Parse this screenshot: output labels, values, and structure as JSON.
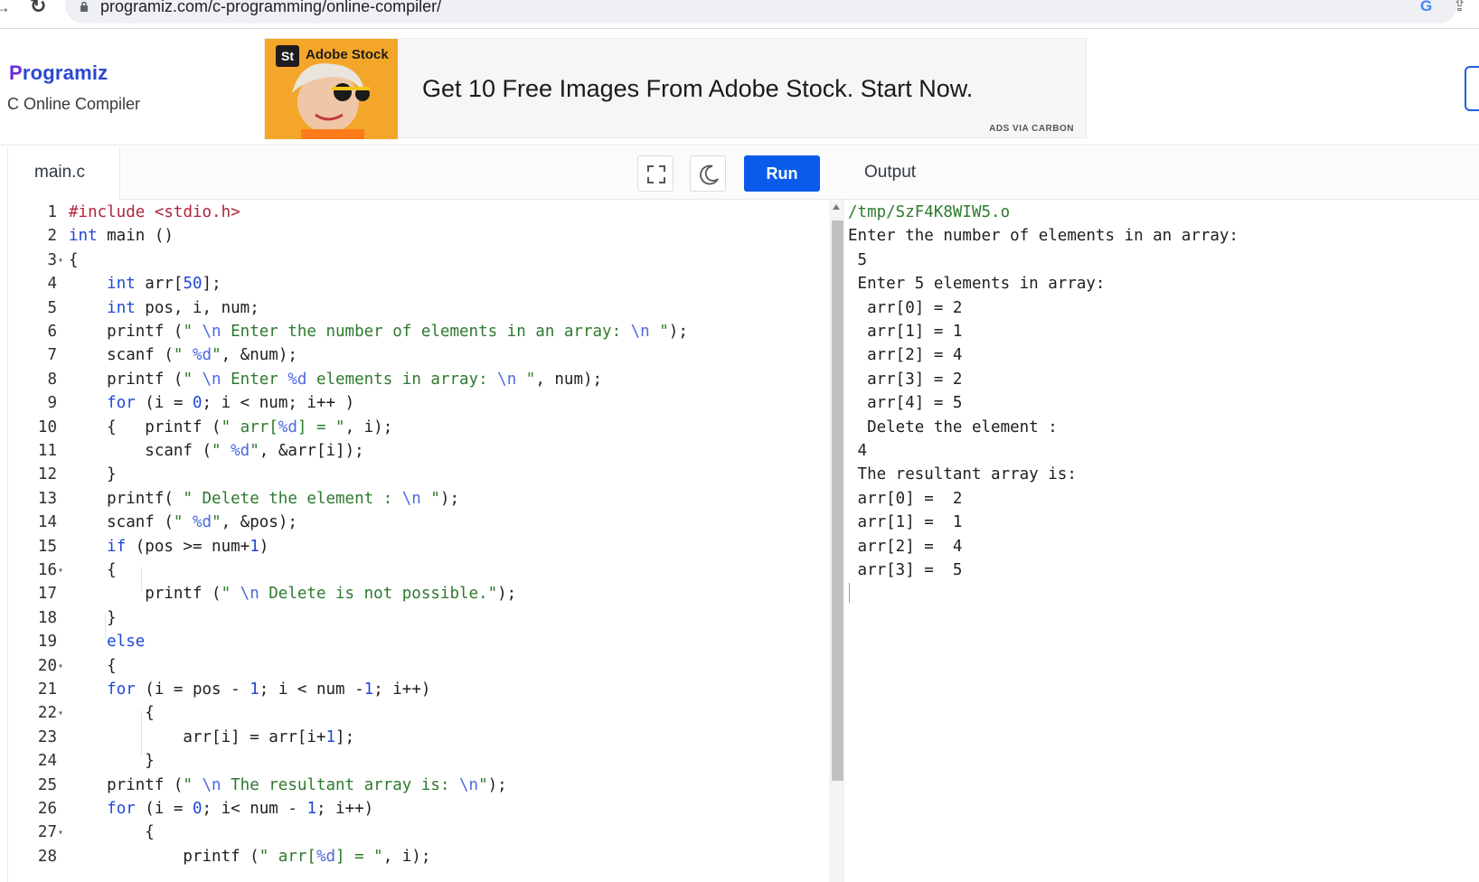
{
  "browser": {
    "url": "programiz.com/c-programming/online-compiler/",
    "back_glyph": "→",
    "reload_glyph": "↻",
    "google_glyph": "G",
    "share_glyph": "⇪"
  },
  "header": {
    "logo_p": "P",
    "logo_rest": "rogramiz",
    "subtitle": "C Online Compiler"
  },
  "ad": {
    "badge": "St",
    "brand": "Adobe Stock",
    "headline": "Get 10 Free Images From Adobe Stock. Start Now.",
    "credit": "ADS VIA CARBON"
  },
  "editor": {
    "file_tab": "main.c",
    "run_label": "Run",
    "lines": [
      {
        "n": "1",
        "fold": "",
        "tokens": [
          [
            "inc",
            "#include"
          ],
          [
            "",
            " "
          ],
          [
            "inc",
            "<stdio.h>"
          ]
        ]
      },
      {
        "n": "2",
        "fold": "",
        "tokens": [
          [
            "kw",
            "int"
          ],
          [
            "",
            " main ()"
          ]
        ]
      },
      {
        "n": "3",
        "fold": "▾",
        "tokens": [
          [
            "",
            "{"
          ]
        ]
      },
      {
        "n": "4",
        "fold": "",
        "tokens": [
          [
            "",
            "    "
          ],
          [
            "kw",
            "int"
          ],
          [
            "",
            " arr["
          ],
          [
            "num",
            "50"
          ],
          [
            "",
            "];"
          ]
        ]
      },
      {
        "n": "5",
        "fold": "",
        "tokens": [
          [
            "",
            "    "
          ],
          [
            "kw",
            "int"
          ],
          [
            "",
            " pos, i, num;"
          ]
        ]
      },
      {
        "n": "6",
        "fold": "",
        "tokens": [
          [
            "",
            "    printf ("
          ],
          [
            "str",
            "\" "
          ],
          [
            "esc",
            "\\n"
          ],
          [
            "str",
            " Enter the number of elements in an array: "
          ],
          [
            "esc",
            "\\n"
          ],
          [
            "str",
            " \""
          ],
          [
            "",
            ");"
          ]
        ]
      },
      {
        "n": "7",
        "fold": "",
        "tokens": [
          [
            "",
            "    scanf ("
          ],
          [
            "str",
            "\" "
          ],
          [
            "esc",
            "%d"
          ],
          [
            "str",
            "\""
          ],
          [
            "",
            ", &num);"
          ]
        ]
      },
      {
        "n": "8",
        "fold": "",
        "tokens": [
          [
            "",
            "    printf ("
          ],
          [
            "str",
            "\" "
          ],
          [
            "esc",
            "\\n"
          ],
          [
            "str",
            " Enter "
          ],
          [
            "esc",
            "%d"
          ],
          [
            "str",
            " elements in array: "
          ],
          [
            "esc",
            "\\n"
          ],
          [
            "str",
            " \""
          ],
          [
            "",
            ", num);"
          ]
        ]
      },
      {
        "n": "9",
        "fold": "",
        "tokens": [
          [
            "",
            "    "
          ],
          [
            "kw",
            "for"
          ],
          [
            "",
            " (i = "
          ],
          [
            "num",
            "0"
          ],
          [
            "",
            "; i < num; i++ )"
          ]
        ]
      },
      {
        "n": "10",
        "fold": "",
        "tokens": [
          [
            "",
            "    {   printf ("
          ],
          [
            "str",
            "\" arr["
          ],
          [
            "esc",
            "%d"
          ],
          [
            "str",
            "] = \""
          ],
          [
            "",
            ", i);"
          ]
        ]
      },
      {
        "n": "11",
        "fold": "",
        "tokens": [
          [
            "",
            "        scanf ("
          ],
          [
            "str",
            "\" "
          ],
          [
            "esc",
            "%d"
          ],
          [
            "str",
            "\""
          ],
          [
            "",
            ", &arr[i]);"
          ]
        ]
      },
      {
        "n": "12",
        "fold": "",
        "tokens": [
          [
            "",
            "    }"
          ]
        ]
      },
      {
        "n": "13",
        "fold": "",
        "tokens": [
          [
            "",
            "    printf( "
          ],
          [
            "str",
            "\" Delete the element : "
          ],
          [
            "esc",
            "\\n"
          ],
          [
            "str",
            " \""
          ],
          [
            "",
            ");"
          ]
        ]
      },
      {
        "n": "14",
        "fold": "",
        "tokens": [
          [
            "",
            "    scanf ("
          ],
          [
            "str",
            "\" "
          ],
          [
            "esc",
            "%d"
          ],
          [
            "str",
            "\""
          ],
          [
            "",
            ", &pos);"
          ]
        ]
      },
      {
        "n": "15",
        "fold": "",
        "tokens": [
          [
            "",
            "    "
          ],
          [
            "kw",
            "if"
          ],
          [
            "",
            " (pos >= num+"
          ],
          [
            "num",
            "1"
          ],
          [
            "",
            ")"
          ]
        ]
      },
      {
        "n": "16",
        "fold": "▾",
        "tokens": [
          [
            "",
            "    {"
          ]
        ]
      },
      {
        "n": "17",
        "fold": "",
        "tokens": [
          [
            "",
            "        printf ("
          ],
          [
            "str",
            "\" "
          ],
          [
            "esc",
            "\\n"
          ],
          [
            "str",
            " Delete is not possible.\""
          ],
          [
            "",
            ");"
          ]
        ]
      },
      {
        "n": "18",
        "fold": "",
        "tokens": [
          [
            "",
            "    }"
          ]
        ]
      },
      {
        "n": "19",
        "fold": "",
        "tokens": [
          [
            "",
            "    "
          ],
          [
            "kw",
            "else"
          ]
        ]
      },
      {
        "n": "20",
        "fold": "▾",
        "tokens": [
          [
            "",
            "    {"
          ]
        ]
      },
      {
        "n": "21",
        "fold": "",
        "tokens": [
          [
            "",
            "    "
          ],
          [
            "kw",
            "for"
          ],
          [
            "",
            " (i = pos - "
          ],
          [
            "num",
            "1"
          ],
          [
            "",
            "; i < num -"
          ],
          [
            "num",
            "1"
          ],
          [
            "",
            "; i++)"
          ]
        ]
      },
      {
        "n": "22",
        "fold": "▾",
        "tokens": [
          [
            "",
            "        {"
          ]
        ]
      },
      {
        "n": "23",
        "fold": "",
        "tokens": [
          [
            "",
            "            arr[i] = arr[i+"
          ],
          [
            "num",
            "1"
          ],
          [
            "",
            "];"
          ]
        ]
      },
      {
        "n": "24",
        "fold": "",
        "tokens": [
          [
            "",
            "        }"
          ]
        ]
      },
      {
        "n": "25",
        "fold": "",
        "tokens": [
          [
            "",
            "    printf ("
          ],
          [
            "str",
            "\" "
          ],
          [
            "esc",
            "\\n"
          ],
          [
            "str",
            " The resultant array is: "
          ],
          [
            "esc",
            "\\n"
          ],
          [
            "str",
            "\""
          ],
          [
            "",
            ");"
          ]
        ]
      },
      {
        "n": "26",
        "fold": "",
        "tokens": [
          [
            "",
            "    "
          ],
          [
            "kw",
            "for"
          ],
          [
            "",
            " (i = "
          ],
          [
            "num",
            "0"
          ],
          [
            "",
            "; i< num - "
          ],
          [
            "num",
            "1"
          ],
          [
            "",
            "; i++)"
          ]
        ]
      },
      {
        "n": "27",
        "fold": "▾",
        "tokens": [
          [
            "",
            "        {"
          ]
        ]
      },
      {
        "n": "28",
        "fold": "",
        "tokens": [
          [
            "",
            "            printf ("
          ],
          [
            "str",
            "\" arr["
          ],
          [
            "esc",
            "%d"
          ],
          [
            "str",
            "] = \""
          ],
          [
            "",
            ", i);"
          ]
        ]
      }
    ]
  },
  "output": {
    "title": "Output",
    "lines": [
      {
        "cls": "out-path",
        "text": "/tmp/SzF4K8WIW5.o"
      },
      {
        "cls": "",
        "text": "Enter the number of elements in an array:"
      },
      {
        "cls": "",
        "text": " 5"
      },
      {
        "cls": "",
        "text": " Enter 5 elements in array:"
      },
      {
        "cls": "",
        "text": "  arr[0] = 2"
      },
      {
        "cls": "",
        "text": "  arr[1] = 1"
      },
      {
        "cls": "",
        "text": "  arr[2] = 4"
      },
      {
        "cls": "",
        "text": "  arr[3] = 2"
      },
      {
        "cls": "",
        "text": "  arr[4] = 5"
      },
      {
        "cls": "",
        "text": "  Delete the element :"
      },
      {
        "cls": "",
        "text": " 4"
      },
      {
        "cls": "",
        "text": " The resultant array is:"
      },
      {
        "cls": "",
        "text": " arr[0] =  2"
      },
      {
        "cls": "",
        "text": " arr[1] =  1"
      },
      {
        "cls": "",
        "text": " arr[2] =  4"
      },
      {
        "cls": "",
        "text": " arr[3] =  5"
      }
    ]
  },
  "colors": {
    "run_button": "#0a5bea",
    "keyword": "#1f48d6",
    "string": "#2d7a2d",
    "include": "#b0243a"
  }
}
